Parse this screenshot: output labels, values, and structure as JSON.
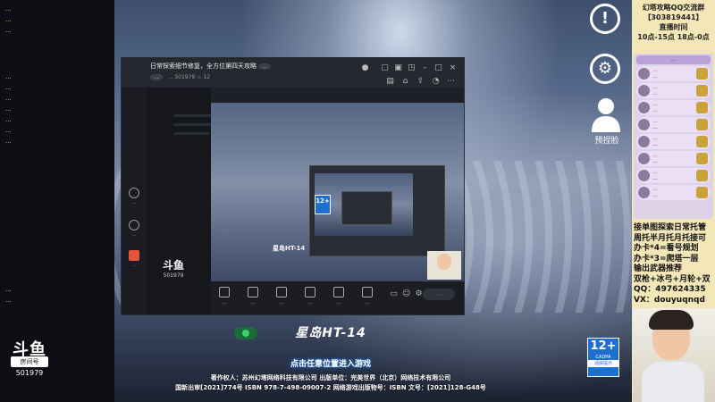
{
  "sidebar": {
    "lines": [
      {
        "text": "...",
        "hl": false
      },
      {
        "text": "...",
        "hl": false
      },
      {
        "text": "...",
        "hl": false
      },
      {
        "text": "...",
        "hl": false
      },
      {
        "text": "...",
        "hl": false
      },
      {
        "text": "...",
        "hl": false
      },
      {
        "text": "...",
        "hl": false
      },
      {
        "text": "...",
        "hl": false
      },
      {
        "text": "...",
        "hl": false
      },
      {
        "text": "...",
        "hl": false
      }
    ],
    "bottom_lines": [
      "...",
      "..."
    ],
    "logo": {
      "mark": "斗鱼",
      "sub": "房间号",
      "room_id": "501979"
    }
  },
  "overlay": {
    "icon1": "!",
    "icon2": "⚙",
    "bottom_label": "预捏脸"
  },
  "right_panel": {
    "title_lines": [
      "幻塔攻略QQ交流群",
      "【303819441】",
      "直播时间",
      "10点-15点 18点-0点"
    ],
    "list_head": "...",
    "items": [
      {
        "name": "...",
        "text": "..."
      },
      {
        "name": "...",
        "text": "..."
      },
      {
        "name": "...",
        "text": "..."
      },
      {
        "name": "...",
        "text": "..."
      },
      {
        "name": "...",
        "text": "..."
      },
      {
        "name": "...",
        "text": "..."
      },
      {
        "name": "...",
        "text": "..."
      },
      {
        "name": "...",
        "text": "..."
      }
    ],
    "info_lines": [
      "接单图探索日常托管",
      "周托半月托月托接可",
      "办卡*4=看号规划",
      "办卡*3=爬塔一层",
      "输出武器推荐",
      "双枪+冰弓+月轮+双",
      "QQ：497624335",
      "VX：douyuqnqd"
    ]
  },
  "app": {
    "title": "日常探索细节修复，全方位第四天攻略",
    "title_tag": "...",
    "sub_tag": "...",
    "sub_text": "...",
    "room_id": "501979",
    "views": "12",
    "nav": [
      {
        "label": "...",
        "icon": "circle"
      },
      {
        "label": "...",
        "icon": "circle"
      },
      {
        "label": "...",
        "icon": "square",
        "red": true
      }
    ],
    "stage_title": "星岛HT-14",
    "toolbar": [
      {
        "label": "..."
      },
      {
        "label": "..."
      },
      {
        "label": "..."
      },
      {
        "label": "..."
      },
      {
        "label": "..."
      },
      {
        "label": "..."
      }
    ],
    "input_placeholder": "..."
  },
  "game": {
    "title": "星岛HT-14",
    "cta": "点击任意位置进入游戏",
    "age_rating": "12+",
    "age_cadpa": "CADPA",
    "age_tip": "适龄提示",
    "legal_line1": "著作权人：苏州幻塔网络科技有限公司   出版单位：完美世界（北京）网络技术有限公司",
    "legal_line2": "国新出审[2021]774号   ISBN 978-7-498-09007-2   网络游戏出版物号：ISBN   文号：[2021]128-G48号"
  },
  "colors": {
    "panel_bg": "#f3e6b7",
    "accent_blue": "#1e6fd0",
    "red_nick": "#c0392b"
  }
}
